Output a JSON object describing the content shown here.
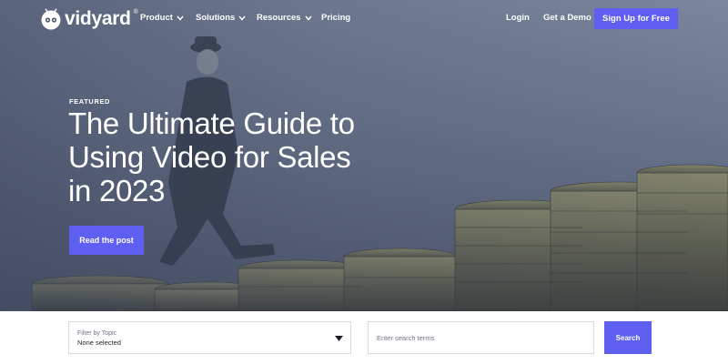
{
  "brand": {
    "name": "vidyard",
    "registered": "®"
  },
  "nav": {
    "links": [
      {
        "label": "Product"
      },
      {
        "label": "Solutions"
      },
      {
        "label": "Resources"
      },
      {
        "label": "Pricing"
      }
    ],
    "login": "Login",
    "demo": "Get a Demo",
    "signup": "Sign Up for Free"
  },
  "hero": {
    "eyebrow": "FEATURED",
    "headline": "The Ultimate Guide to Using Video for Sales in 2023",
    "cta": "Read the post"
  },
  "filter": {
    "topic_label": "Filter by Topic",
    "topic_value": "None selected",
    "search_placeholder": "Enter search terms",
    "search_button": "Search"
  },
  "colors": {
    "accent": "#5e5ef0",
    "hero_bg": "#6f7b92",
    "text_light": "#ffffff"
  },
  "icons": [
    "vidyard-logo-icon",
    "chevron-down-icon",
    "caret-down-icon"
  ]
}
